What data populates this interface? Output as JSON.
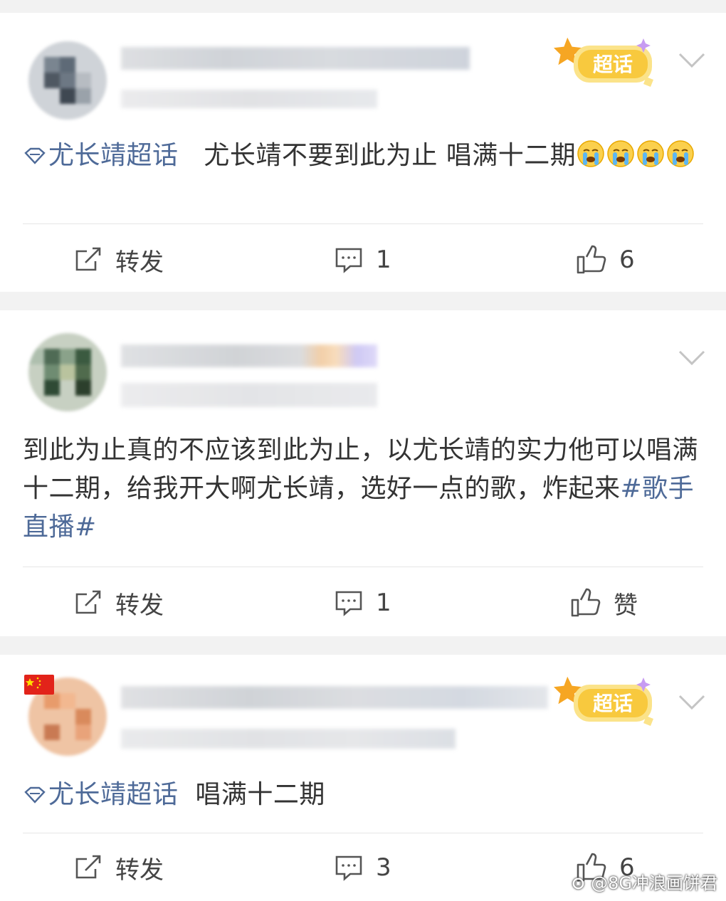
{
  "posts": [
    {
      "badge_label": "超话",
      "topic": "尤长靖超话",
      "text": "尤长靖不要到此为止 唱满十二期",
      "emoji_name": "crying-face",
      "actions": {
        "repost_label": "转发",
        "comment_count": "1",
        "like_label": "6"
      }
    },
    {
      "badge_label": "",
      "text": "到此为止真的不应该到此为止，以尤长靖的实力他可以唱满十二期，给我开大啊尤长靖，选好一点的歌，炸起来",
      "hashtag": "#歌手直播#",
      "actions": {
        "repost_label": "转发",
        "comment_count": "1",
        "like_label": "赞"
      }
    },
    {
      "badge_label": "超话",
      "topic": "尤长靖超话",
      "text": "唱满十二期",
      "actions": {
        "repost_label": "转发",
        "comment_count": "3",
        "like_label": "6"
      }
    }
  ],
  "watermark": {
    "text": "@8G冲浪画饼君"
  },
  "colors": {
    "topic": "#4e6a98",
    "badge": "#f5c542",
    "background": "#f2f2f2"
  }
}
